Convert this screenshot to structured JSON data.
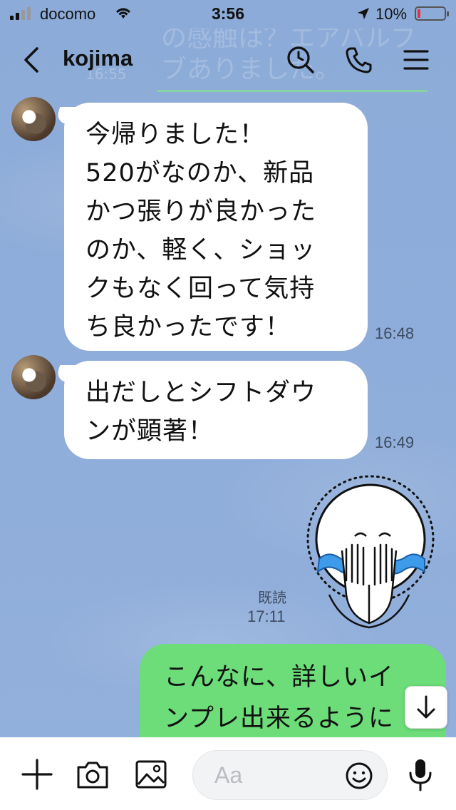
{
  "status_bar": {
    "carrier": "docomo",
    "time": "3:56",
    "battery": "10%"
  },
  "header": {
    "title": "kojima",
    "background_text_line1": "の感触は？エアバルブ",
    "background_text_line2": "ブありました。",
    "background_time": "16:55"
  },
  "messages": [
    {
      "lines": [
        "今帰りました！",
        "520がなのか、新品",
        "かつ張りが良かった",
        "のか、軽く、ショッ",
        "クもなく回って気持",
        "ち良かったです！"
      ],
      "time": "16:48"
    },
    {
      "lines": [
        "出だしとシフトダウ",
        "ンが顕著！"
      ],
      "time": "16:49"
    }
  ],
  "sticker_meta": {
    "read_label": "既読",
    "time": "17:11"
  },
  "my_message": {
    "lines": [
      "こんなに、詳しいイ",
      "ンプレ出来るように"
    ]
  },
  "input": {
    "placeholder": "Aa"
  },
  "colors": {
    "background": "#8dacd9",
    "my_bubble": "#6cdd78",
    "their_bubble": "#ffffff"
  }
}
